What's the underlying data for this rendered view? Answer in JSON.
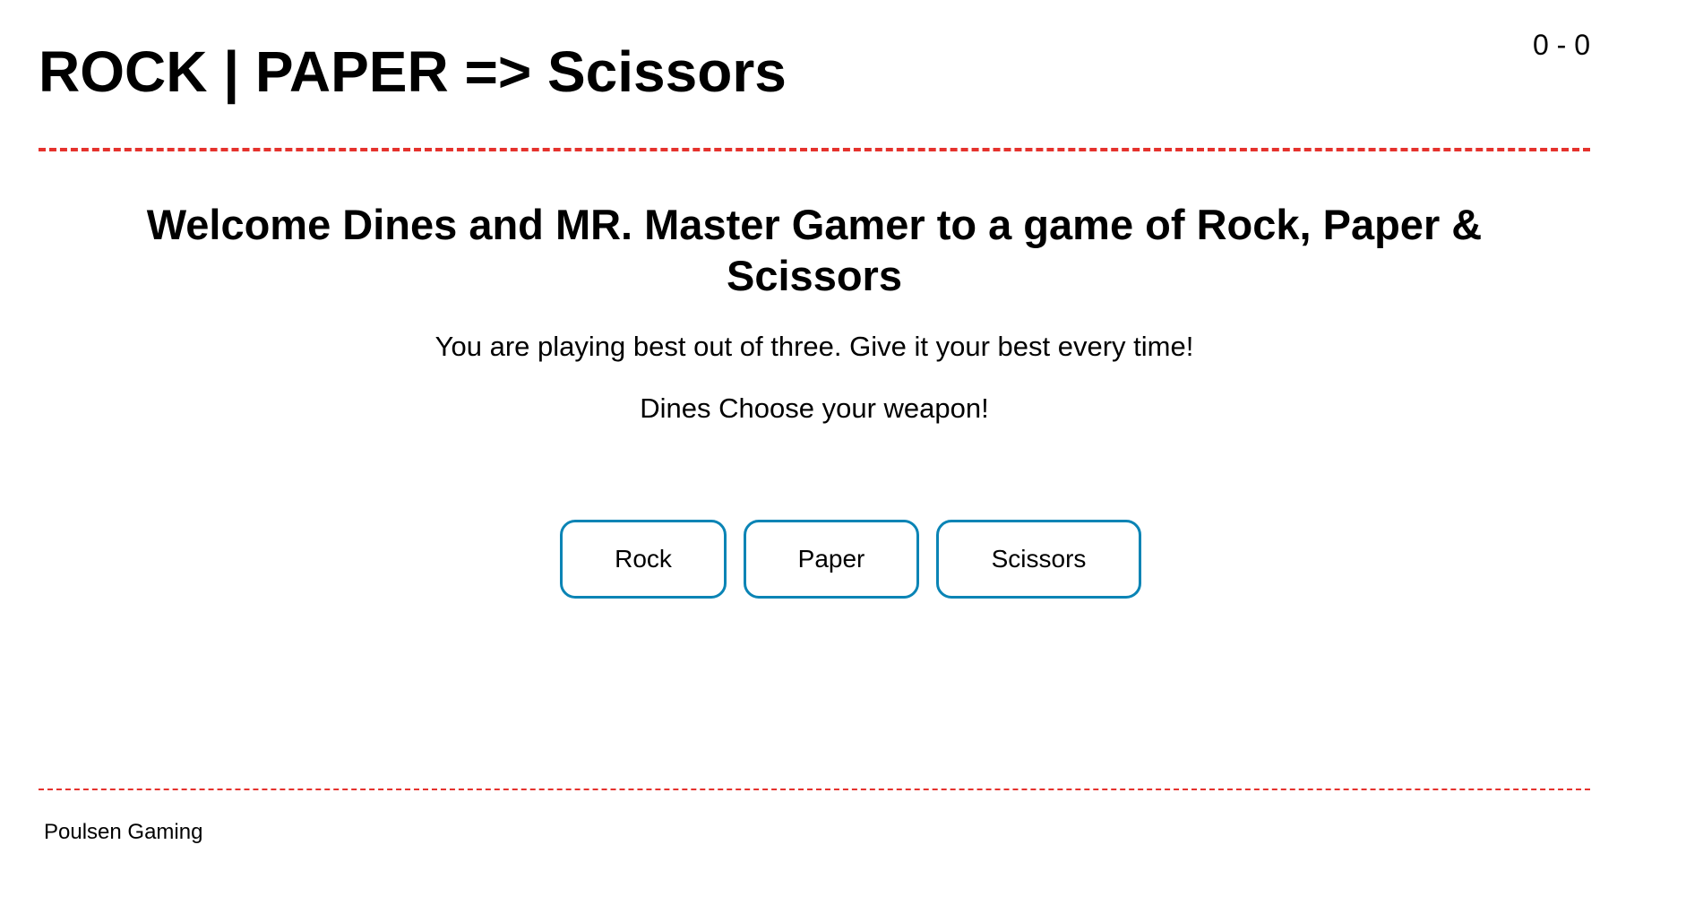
{
  "header": {
    "title": "ROCK | PAPER => Scissors",
    "score": "0 - 0"
  },
  "main": {
    "welcome": "Welcome Dines and MR. Master Gamer to a game of Rock, Paper & Scissors",
    "intro": "You are playing best out of three. Give it your best every time!",
    "prompt": "Dines Choose your weapon!"
  },
  "weapons": {
    "rock": "Rock",
    "paper": "Paper",
    "scissors": "Scissors"
  },
  "footer": {
    "text": "Poulsen Gaming"
  },
  "colors": {
    "divider": "#e5322d",
    "button_border": "#0a84b5"
  }
}
